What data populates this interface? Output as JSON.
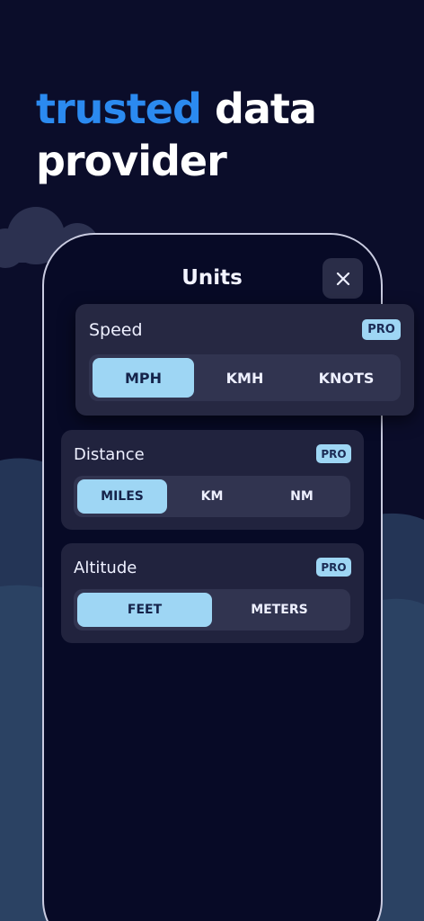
{
  "headline": {
    "accent_word": "trusted",
    "rest_line1": "data",
    "line2": "provider"
  },
  "screen": {
    "title": "Units",
    "close_icon": "close-icon"
  },
  "cards": {
    "speed": {
      "label": "Speed",
      "badge": "PRO",
      "options": [
        "MPH",
        "KMH",
        "KNOTS"
      ],
      "selected": "MPH"
    },
    "distance": {
      "label": "Distance",
      "badge": "PRO",
      "options": [
        "MILES",
        "KM",
        "NM"
      ],
      "selected": "MILES"
    },
    "altitude": {
      "label": "Altitude",
      "badge": "PRO",
      "options": [
        "FEET",
        "METERS"
      ],
      "selected": "FEET"
    }
  },
  "colors": {
    "background": "#0b0d2a",
    "accent": "#2b8af0",
    "selected_segment": "#9ed6f4",
    "card": "#21233e"
  }
}
